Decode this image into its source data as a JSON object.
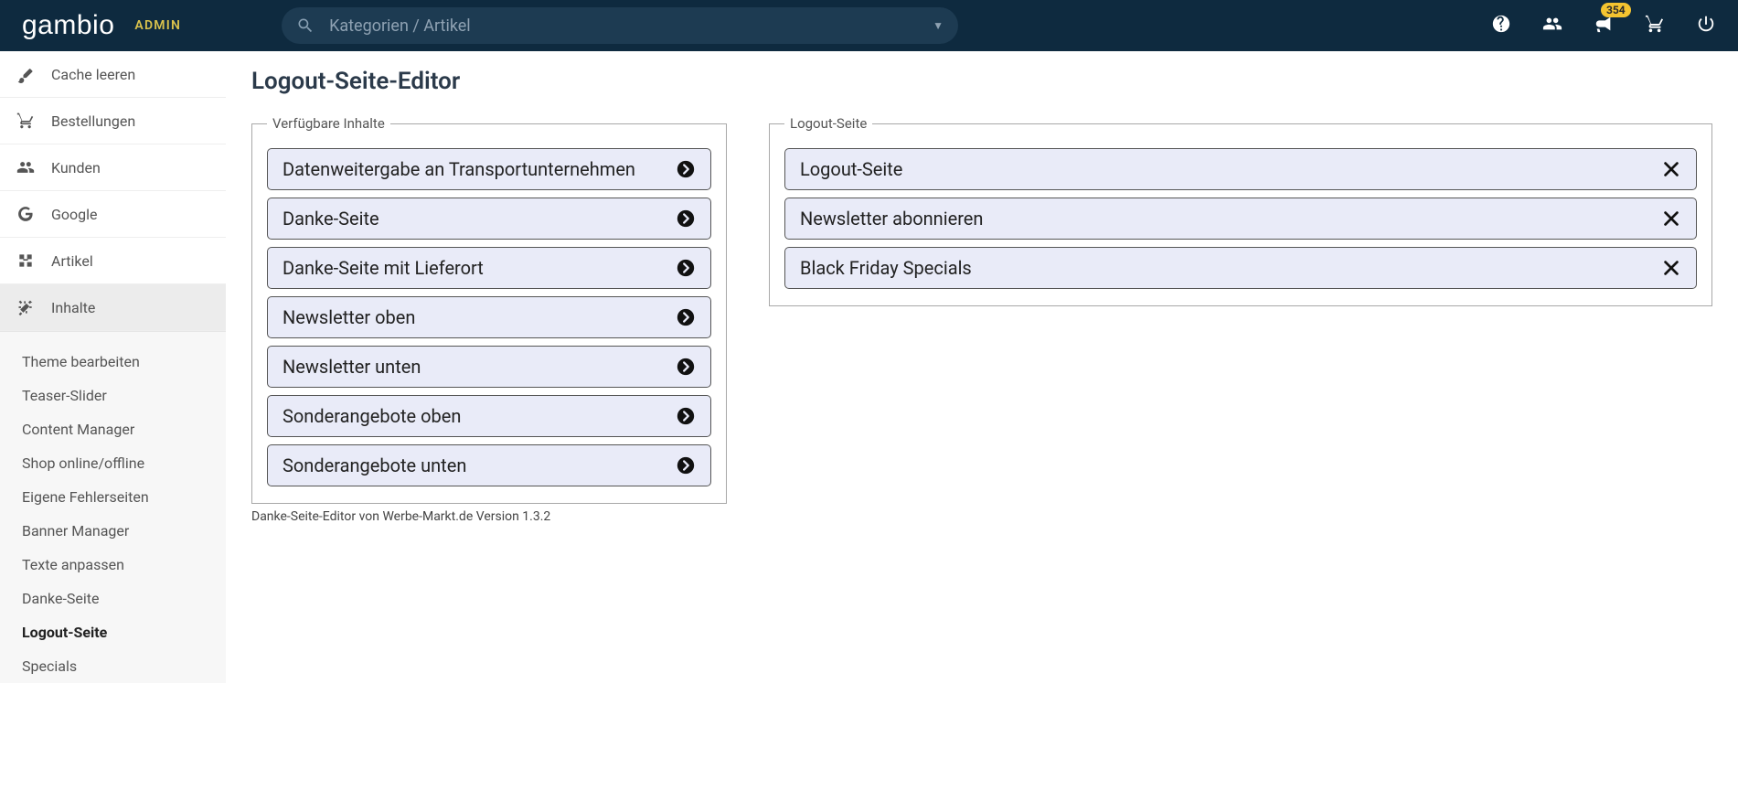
{
  "header": {
    "brand": "gambio",
    "admin_tag": "ADMIN",
    "search_placeholder": "Kategorien / Artikel",
    "badge_count": "354"
  },
  "sidebar": {
    "primary": [
      {
        "label": "Cache leeren",
        "icon": "brush"
      },
      {
        "label": "Bestellungen",
        "icon": "cart"
      },
      {
        "label": "Kunden",
        "icon": "users"
      },
      {
        "label": "Google",
        "icon": "google"
      },
      {
        "label": "Artikel",
        "icon": "sitemap"
      },
      {
        "label": "Inhalte",
        "icon": "wand"
      }
    ],
    "sub": [
      {
        "label": "Theme bearbeiten"
      },
      {
        "label": "Teaser-Slider"
      },
      {
        "label": "Content Manager"
      },
      {
        "label": "Shop online/offline"
      },
      {
        "label": "Eigene Fehlerseiten"
      },
      {
        "label": "Banner Manager"
      },
      {
        "label": "Texte anpassen"
      },
      {
        "label": "Danke-Seite"
      },
      {
        "label": "Logout-Seite"
      },
      {
        "label": "Specials"
      }
    ],
    "active_primary": 5,
    "active_sub": 8
  },
  "page": {
    "title": "Logout-Seite-Editor",
    "available_legend": "Verfügbare Inhalte",
    "target_legend": "Logout-Seite",
    "available": [
      "Datenweitergabe an Transportunternehmen",
      "Danke-Seite",
      "Danke-Seite mit Lieferort",
      "Newsletter oben",
      "Newsletter unten",
      "Sonderangebote oben",
      "Sonderangebote unten"
    ],
    "target": [
      "Logout-Seite",
      "Newsletter abonnieren",
      "Black Friday Specials"
    ],
    "footnote": "Danke-Seite-Editor von Werbe-Markt.de Version 1.3.2"
  }
}
